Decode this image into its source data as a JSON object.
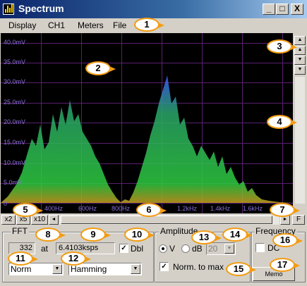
{
  "window": {
    "title": "Spectrum",
    "min_label": "_",
    "max_label": "□",
    "close_label": "X"
  },
  "menu": [
    "Display",
    "CH1",
    "Meters",
    "File"
  ],
  "plot": {
    "y_ticks": [
      "40.0mV",
      "35.0mV",
      "30.0mV",
      "25.0mV",
      "20.0mV",
      "15.0mV",
      "10.0mV",
      "5.0mV",
      "0"
    ],
    "x_ticks": [
      "400Hz",
      "600Hz",
      "800Hz",
      "1.2kHz",
      "1.4kHz",
      "1.6kHz"
    ]
  },
  "zoom": {
    "x2": "x2",
    "x5": "x5",
    "x10": "x10"
  },
  "scroll": {
    "left": "◄",
    "right": "►",
    "f": "F"
  },
  "fft": {
    "title": "FFT",
    "size": "332",
    "at": "at",
    "rate": "6.4103ksps",
    "dbl_label": "Dbl",
    "dbl_checked": true,
    "mode": "Norm",
    "window": "Hamming"
  },
  "amplitude": {
    "title": "Amplitude",
    "v_label": "V",
    "db_label": "dB",
    "db_value": "20",
    "v_selected": true,
    "norm_label": "Norm. to max",
    "norm_checked": true
  },
  "frequency": {
    "title": "Frequency",
    "dc_label": "DC",
    "memo_label": "Memo"
  },
  "callouts": [
    "1",
    "2",
    "3",
    "4",
    "5",
    "6",
    "7",
    "8",
    "9",
    "10",
    "11",
    "12",
    "13",
    "14",
    "15",
    "16",
    "17"
  ],
  "colors": {
    "title_start": "#0a246a",
    "title_end": "#a6caf0",
    "plot_bg": "#000000",
    "grid": "#5a2070",
    "trace_low": "#2ecc40",
    "trace_high": "#3a5fff",
    "callout_border": "#f39c12"
  }
}
